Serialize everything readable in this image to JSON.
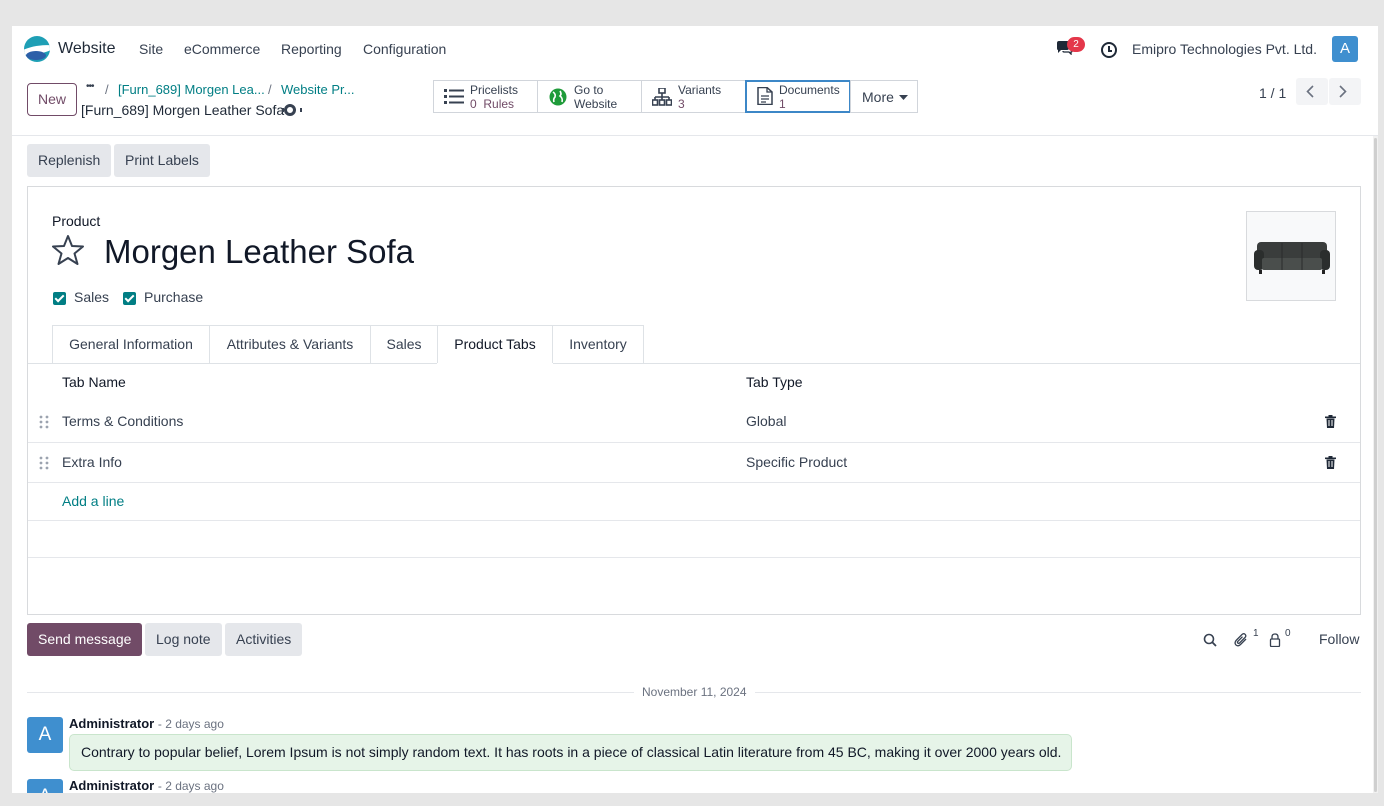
{
  "navbar": {
    "app_name": "Website",
    "menu": [
      "Site",
      "eCommerce",
      "Reporting",
      "Configuration"
    ],
    "messages_badge": "2",
    "company": "Emipro Technologies Pvt. Ltd.",
    "user_initial": "A"
  },
  "control_panel": {
    "new_label": "New",
    "breadcrumb_ellipsis": "•••",
    "breadcrumbs": [
      "[Furn_689] Morgen Lea...",
      "Website Pr..."
    ],
    "breadcrumb_sep": "/",
    "record_title": "[Furn_689] Morgen Leather Sofa",
    "smart_buttons": [
      {
        "label": "Pricelists",
        "value": "0",
        "value_suffix": "Rules",
        "icon": "list-icon"
      },
      {
        "label": "Go to",
        "label2": "Website",
        "icon": "globe-icon"
      },
      {
        "label": "Variants",
        "value": "3",
        "icon": "sitemap-icon"
      },
      {
        "label": "Documents",
        "value": "1",
        "icon": "document-icon"
      }
    ],
    "more_label": "More",
    "pager": "1 / 1"
  },
  "status_bar": {
    "buttons": [
      "Replenish",
      "Print Labels"
    ]
  },
  "form": {
    "product_label": "Product",
    "product_name": "Morgen Leather Sofa",
    "checkboxes": [
      {
        "label": "Sales",
        "checked": true
      },
      {
        "label": "Purchase",
        "checked": true
      }
    ],
    "tabs": [
      "General Information",
      "Attributes & Variants",
      "Sales",
      "Product Tabs",
      "Inventory"
    ],
    "active_tab": "Product Tabs",
    "table": {
      "headers": [
        "Tab Name",
        "Tab Type"
      ],
      "rows": [
        {
          "name": "Terms & Conditions",
          "type": "Global"
        },
        {
          "name": "Extra Info",
          "type": "Specific Product"
        }
      ],
      "add_line": "Add a line"
    }
  },
  "chatter": {
    "send_message": "Send message",
    "log_note": "Log note",
    "activities": "Activities",
    "attachments_count": "1",
    "followers_count": "0",
    "follow_label": "Follow",
    "date_separator": "November 11, 2024",
    "messages": [
      {
        "author": "Administrator",
        "time": "- 2 days ago",
        "initial": "A",
        "body": "Contrary to popular belief, Lorem Ipsum is not simply random text. It has roots in a piece of classical Latin literature from 45 BC, making it over 2000 years old."
      },
      {
        "author": "Administrator",
        "time": "- 2 days ago",
        "initial": "A"
      }
    ]
  },
  "colors": {
    "brand": "#714b67",
    "link": "#017e84",
    "badge": "#e4374a",
    "avatar": "#3f8fcf",
    "message_bg": "#e6f4e8"
  }
}
